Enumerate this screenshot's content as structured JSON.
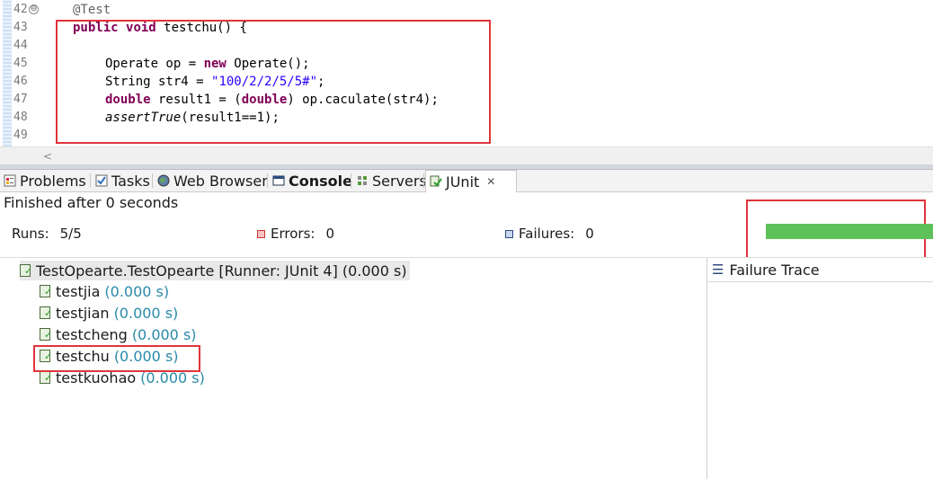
{
  "editor": {
    "line_numbers": [
      "42",
      "43",
      "44",
      "45",
      "46",
      "47",
      "48",
      "49"
    ],
    "code": {
      "annotation": "@Test",
      "l43_kw1": "public",
      "l43_kw2": "void",
      "l43_rest": "testchu() {",
      "l45_a": "Operate op = ",
      "l45_kw": "new",
      "l45_b": " Operate();",
      "l46_a": "String str4 = ",
      "l46_str": "\"100/2/2/5/5#\"",
      "l46_b": ";",
      "l47_kw1": "double",
      "l47_a": " result1 = (",
      "l47_kw2": "double",
      "l47_b": ") op.caculate(str4);",
      "l48_ital": "assertTrue",
      "l48_b": "(result1==1);"
    },
    "fold_glyph": "⊖",
    "scroll_left_glyph": "<"
  },
  "tabs": [
    {
      "label": "Problems",
      "icon": "problems-icon"
    },
    {
      "label": "Tasks",
      "icon": "tasks-icon"
    },
    {
      "label": "Web Browser",
      "icon": "web-browser-icon"
    },
    {
      "label": "Console",
      "icon": "console-icon"
    },
    {
      "label": "Servers",
      "icon": "servers-icon"
    },
    {
      "label": "JUnit",
      "icon": "junit-icon",
      "close": "✕"
    }
  ],
  "junit": {
    "status": "Finished after 0 seconds",
    "runs_label": "Runs:",
    "runs_value": "5/5",
    "errors_label": "Errors:",
    "errors_value": "0",
    "failures_label": "Failures:",
    "failures_value": "0",
    "progress_fraction": 1.0,
    "progress_color": "#5fc15a",
    "root": {
      "name": "TestOpearte.TestOpearte [Runner: JUnit 4]",
      "time": "(0.000 s)"
    },
    "tests": [
      {
        "name": "testjia",
        "time": "(0.000 s)"
      },
      {
        "name": "testjian",
        "time": "(0.000 s)"
      },
      {
        "name": "testcheng",
        "time": "(0.000 s)"
      },
      {
        "name": "testchu",
        "time": "(0.000 s)"
      },
      {
        "name": "testkuohao",
        "time": "(0.000 s)"
      }
    ],
    "failure_trace_label": "Failure Trace"
  },
  "colors": {
    "highlight_box": "#e0343a",
    "keyword": "#7f0055",
    "string": "#2a00ff",
    "time_text": "#2a8aa8"
  }
}
